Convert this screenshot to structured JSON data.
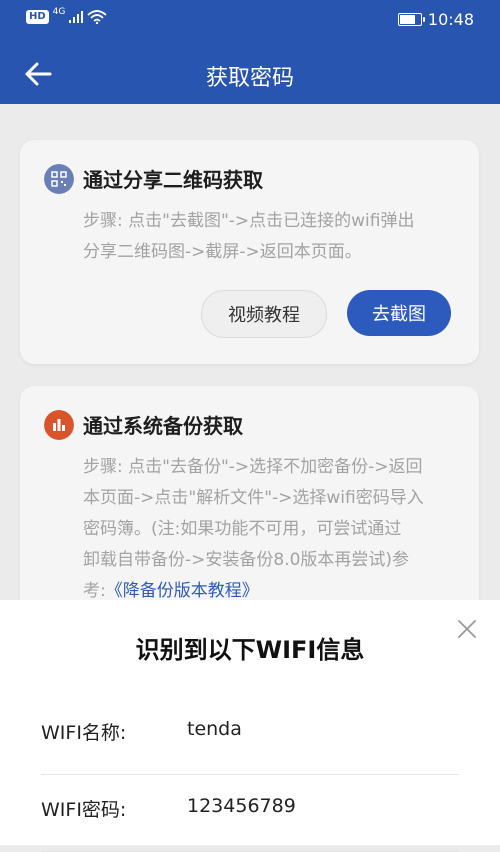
{
  "status_bar": {
    "hd": "HD",
    "network": "4G",
    "time": "10:48"
  },
  "header": {
    "title": "获取密码"
  },
  "card1": {
    "title": "通过分享二维码获取",
    "desc_line1": "步骤: 点击\"去截图\"->点击已连接的wifi弹出",
    "desc_line2": "分享二维码图->截屏->返回本页面。",
    "btn_video": "视频教程",
    "btn_screenshot": "去截图"
  },
  "card2": {
    "title": "通过系统备份获取",
    "desc_line1": "步骤: 点击\"去备份\"->选择不加密备份->返回",
    "desc_line2": "本页面->点击\"解析文件\"->选择wifi密码导入",
    "desc_line3": "密码簿。(注:如果功能不可用，可尝试通过",
    "desc_line4": "卸载自带备份->安装备份8.0版本再尝试)参",
    "desc_prefix5": "考:",
    "desc_link": "《降备份版本教程》"
  },
  "sheet": {
    "title": "识别到以下WIFI信息",
    "name_label": "WIFI名称:",
    "name_value": "tenda",
    "password_label": "WIFI密码:",
    "password_value": "123456789"
  },
  "colors": {
    "primary": "#2855b0",
    "card_icon_1": "#6a7fb8",
    "card_icon_2": "#d9532b"
  }
}
